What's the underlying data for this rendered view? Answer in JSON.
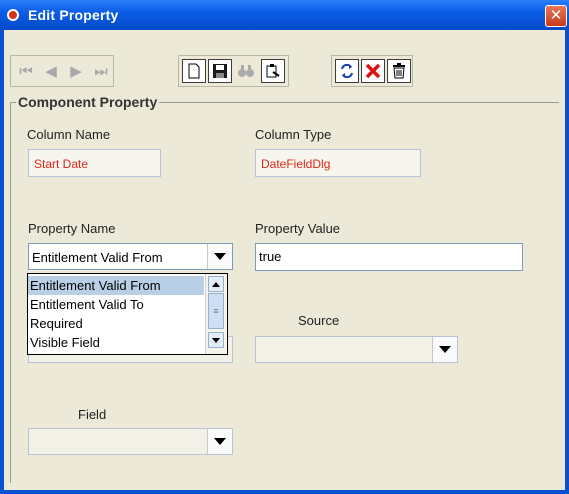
{
  "window": {
    "title": "Edit Property",
    "close_label": "✕"
  },
  "toolbar": {
    "nav_buttons": [
      {
        "name": "first-record-icon",
        "glyph": "⏮"
      },
      {
        "name": "previous-record-icon",
        "glyph": "◀"
      },
      {
        "name": "next-record-icon",
        "glyph": "▶"
      },
      {
        "name": "last-record-icon",
        "glyph": "⏭"
      }
    ],
    "action_buttons": [
      {
        "name": "new-document-icon",
        "glyph": "🗋"
      },
      {
        "name": "save-icon",
        "glyph": "💾"
      },
      {
        "name": "find-binoculars-icon",
        "glyph": "👓"
      },
      {
        "name": "edit-clipboard-icon",
        "glyph": "📋"
      }
    ],
    "edit_buttons": [
      {
        "name": "refresh-icon",
        "glyph": "⟲"
      },
      {
        "name": "delete-x-icon",
        "glyph": "✕"
      },
      {
        "name": "trash-icon",
        "glyph": "🗑"
      }
    ]
  },
  "group": {
    "title": "Component Property"
  },
  "fields": {
    "column_name_label": "Column Name",
    "column_name_value": "Start Date",
    "column_type_label": "Column Type",
    "column_type_value": "DateFieldDlg",
    "property_name_label": "Property Name",
    "property_name_value": "Entitlement Valid From",
    "property_value_label": "Property Value",
    "property_value_value": "true",
    "source_label": "Source",
    "source_value": "",
    "field_label": "Field",
    "field_value": ""
  },
  "dropdown": {
    "options": [
      {
        "label": "Entitlement Valid From",
        "selected": true
      },
      {
        "label": "Entitlement Valid To",
        "selected": false
      },
      {
        "label": "Required",
        "selected": false
      },
      {
        "label": "Visible Field",
        "selected": false
      }
    ]
  },
  "colors": {
    "titlebar": "#0a5de6",
    "readonly_text": "#e0271a",
    "selection": "#b8cfe5"
  }
}
